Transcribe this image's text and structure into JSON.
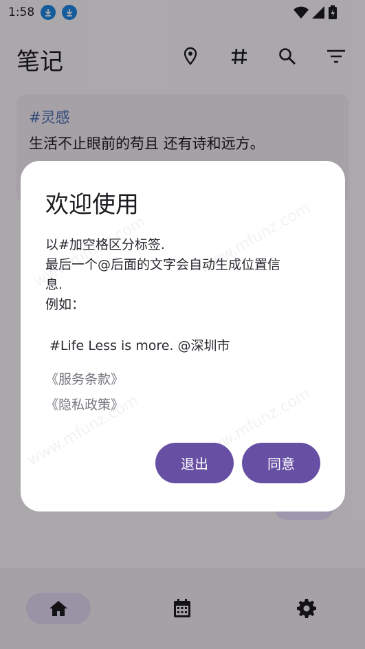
{
  "status_bar": {
    "time": "1:58"
  },
  "app_bar": {
    "title": "笔记",
    "icons": [
      "location-icon",
      "hashtag-icon",
      "search-icon",
      "filter-icon"
    ]
  },
  "notes": [
    {
      "tag": "#灵感",
      "text": "生活不止眼前的苟且 还有诗和远方。"
    }
  ],
  "dialog": {
    "title": "欢迎使用",
    "body_line1": "以#加空格区分标签.",
    "body_line2": "最后一个@后面的文字会自动生成位置信",
    "body_line3": "息.",
    "body_line4": "例如：",
    "example": "#Life Less is more. @深圳市",
    "terms_link": "《服务条款》",
    "privacy_link": "《隐私政策》",
    "exit_button": "退出",
    "agree_button": "同意"
  },
  "bottom_nav": {
    "items": [
      "home-icon",
      "calendar-icon",
      "settings-icon"
    ],
    "selected": "home-icon"
  },
  "colors": {
    "primary": "#6750a4",
    "tag_blue": "#4a6fb5",
    "nav_selected": "#e3d9f3",
    "download_badge": "#1e88e5"
  }
}
